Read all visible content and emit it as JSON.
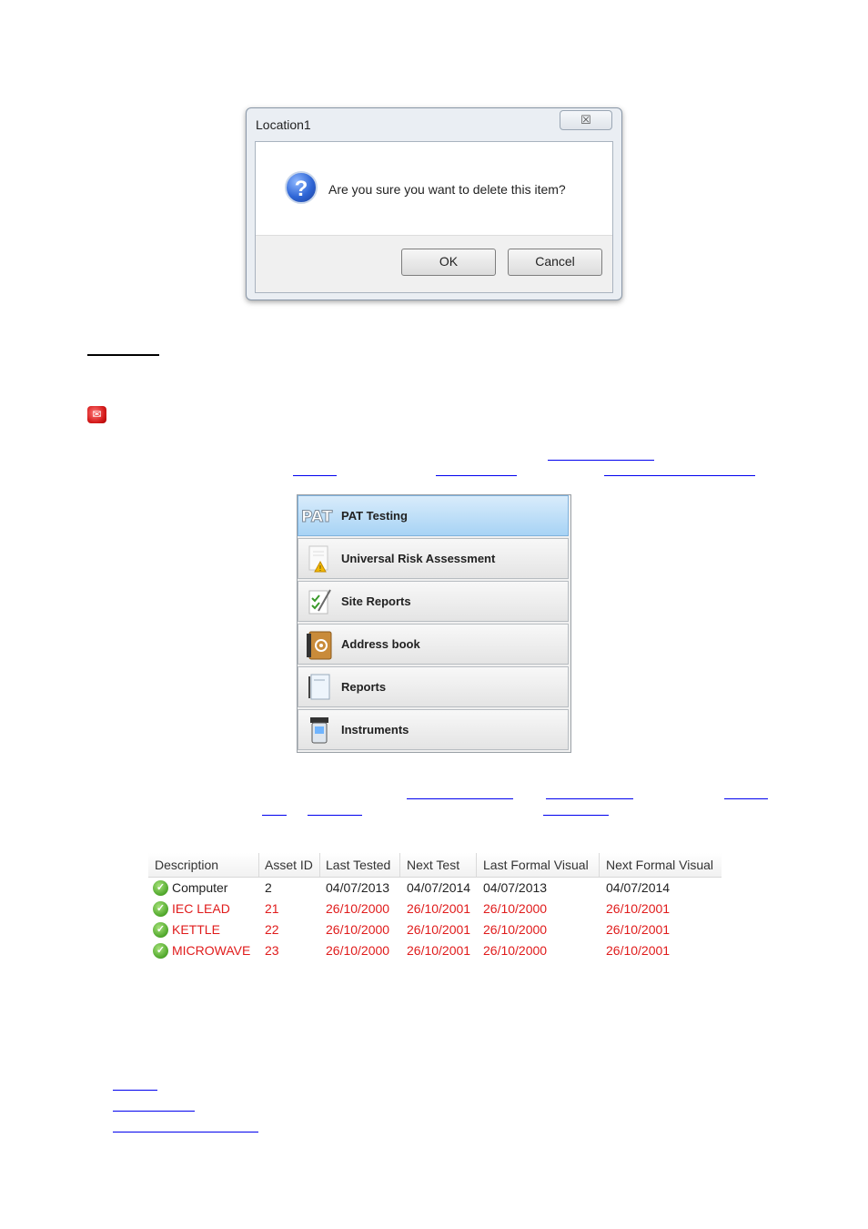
{
  "dialog": {
    "title": "Location1",
    "close_glyph": "☒",
    "message": "Are you sure you want to delete this item?",
    "ok_label": "OK",
    "cancel_label": "Cancel",
    "icon": "question-icon"
  },
  "menu": {
    "items": [
      {
        "label": "PAT Testing",
        "icon": "pat-logo-icon",
        "logo_text": "PAT",
        "active": true
      },
      {
        "label": "Universal Risk Assessment",
        "icon": "risk-assessment-icon"
      },
      {
        "label": "Site Reports",
        "icon": "site-reports-icon"
      },
      {
        "label": "Address book",
        "icon": "address-book-icon"
      },
      {
        "label": "Reports",
        "icon": "reports-icon"
      },
      {
        "label": "Instruments",
        "icon": "instruments-icon"
      }
    ]
  },
  "table": {
    "headers": [
      "Description",
      "Asset ID",
      "Last Tested",
      "Next Test",
      "Last Formal Visual",
      "Next Formal Visual"
    ],
    "rows": [
      {
        "description": "Computer",
        "asset_id": "2",
        "last_tested": "04/07/2013",
        "next_test": "04/07/2014",
        "last_visual": "04/07/2013",
        "next_visual": "04/07/2014",
        "overdue": false
      },
      {
        "description": "IEC LEAD",
        "asset_id": "21",
        "last_tested": "26/10/2000",
        "next_test": "26/10/2001",
        "last_visual": "26/10/2000",
        "next_visual": "26/10/2001",
        "overdue": true
      },
      {
        "description": "KETTLE",
        "asset_id": "22",
        "last_tested": "26/10/2000",
        "next_test": "26/10/2001",
        "last_visual": "26/10/2000",
        "next_visual": "26/10/2001",
        "overdue": true
      },
      {
        "description": "MICROWAVE",
        "asset_id": "23",
        "last_tested": "26/10/2000",
        "next_test": "26/10/2001",
        "last_visual": "26/10/2000",
        "next_visual": "26/10/2001",
        "overdue": true
      }
    ]
  },
  "colors": {
    "overdue_text": "#e01b1b",
    "link_underline": "#0000ee",
    "active_menu": "#a7d3f5"
  }
}
